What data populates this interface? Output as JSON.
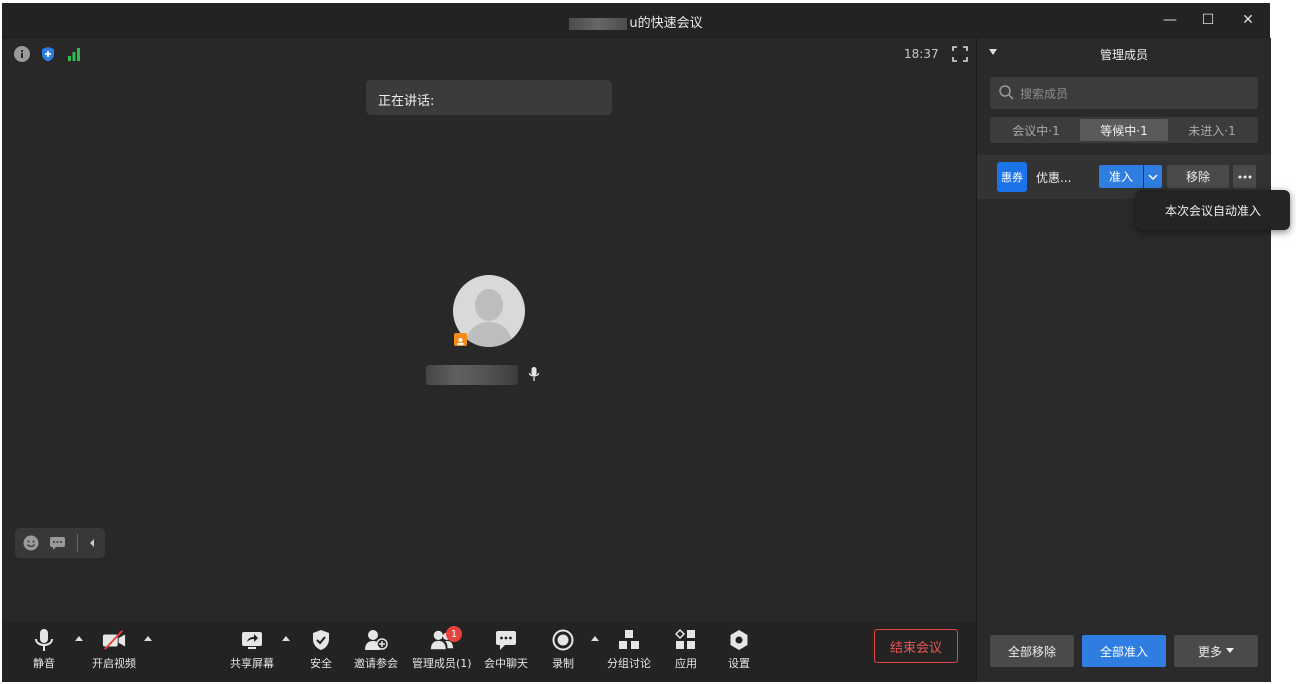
{
  "window": {
    "title_suffix": "u的快速会议",
    "controls": {
      "minimize": "—",
      "maximize": "☐",
      "close": "✕"
    }
  },
  "stage": {
    "time": "18:37",
    "speaking_label": "正在讲话:",
    "status_colors": {
      "info": "#9a9a9a",
      "shield": "#2f7de1",
      "signal": "#2dbb4e"
    }
  },
  "toolbar": {
    "items": [
      {
        "label": "静音"
      },
      {
        "label": "开启视频"
      },
      {
        "label": "共享屏幕"
      },
      {
        "label": "安全"
      },
      {
        "label": "邀请参会"
      },
      {
        "label": "管理成员(1)"
      },
      {
        "label": "会中聊天"
      },
      {
        "label": "录制"
      },
      {
        "label": "分组讨论"
      },
      {
        "label": "应用"
      },
      {
        "label": "设置"
      }
    ],
    "members_badge": "1",
    "end_label": "结束会议"
  },
  "panel": {
    "title": "管理成员",
    "search_placeholder": "搜索成员",
    "tabs": [
      {
        "label": "会议中·1",
        "active": false
      },
      {
        "label": "等候中·1",
        "active": true
      },
      {
        "label": "未进入·1",
        "active": false
      }
    ],
    "member": {
      "avatar_text": "惠券",
      "name": "优惠...",
      "admit_label": "准入",
      "remove_label": "移除"
    },
    "popup_label": "本次会议自动准入",
    "footer": {
      "remove_all": "全部移除",
      "admit_all": "全部准入",
      "more": "更多"
    }
  }
}
